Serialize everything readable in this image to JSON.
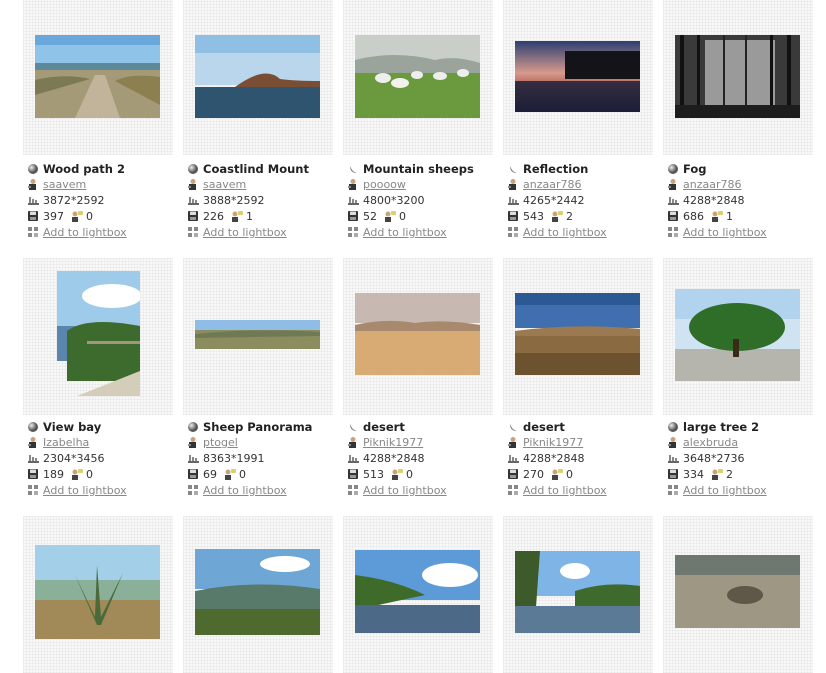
{
  "add_label": "Add to lightbox",
  "items": [
    {
      "title": "Wood path 2",
      "user": "saavem",
      "resolution": "3872*2592",
      "downloads": "397",
      "comments": "0",
      "icon": "sphere-icon"
    },
    {
      "title": "Coastlind Mount",
      "user": "saavem",
      "resolution": "3888*2592",
      "downloads": "226",
      "comments": "1",
      "icon": "sphere-icon"
    },
    {
      "title": "Mountain sheeps",
      "user": "poooow",
      "resolution": "4800*3200",
      "downloads": "52",
      "comments": "0",
      "icon": "crescent-icon"
    },
    {
      "title": "Reflection",
      "user": "anzaar786",
      "resolution": "4265*2442",
      "downloads": "543",
      "comments": "2",
      "icon": "crescent-icon"
    },
    {
      "title": "Fog",
      "user": "anzaar786",
      "resolution": "4288*2848",
      "downloads": "686",
      "comments": "1",
      "icon": "sphere-icon"
    },
    {
      "title": "View bay",
      "user": "Izabelha",
      "resolution": "2304*3456",
      "downloads": "189",
      "comments": "0",
      "icon": "sphere-icon"
    },
    {
      "title": "Sheep Panorama",
      "user": "ptogel",
      "resolution": "8363*1991",
      "downloads": "69",
      "comments": "0",
      "icon": "sphere-icon"
    },
    {
      "title": "desert",
      "user": "Piknik1977",
      "resolution": "4288*2848",
      "downloads": "513",
      "comments": "0",
      "icon": "crescent-icon"
    },
    {
      "title": "desert",
      "user": "Piknik1977",
      "resolution": "4288*2848",
      "downloads": "270",
      "comments": "0",
      "icon": "crescent-icon"
    },
    {
      "title": "large tree 2",
      "user": "alexbruda",
      "resolution": "3648*2736",
      "downloads": "334",
      "comments": "2",
      "icon": "sphere-icon"
    }
  ]
}
